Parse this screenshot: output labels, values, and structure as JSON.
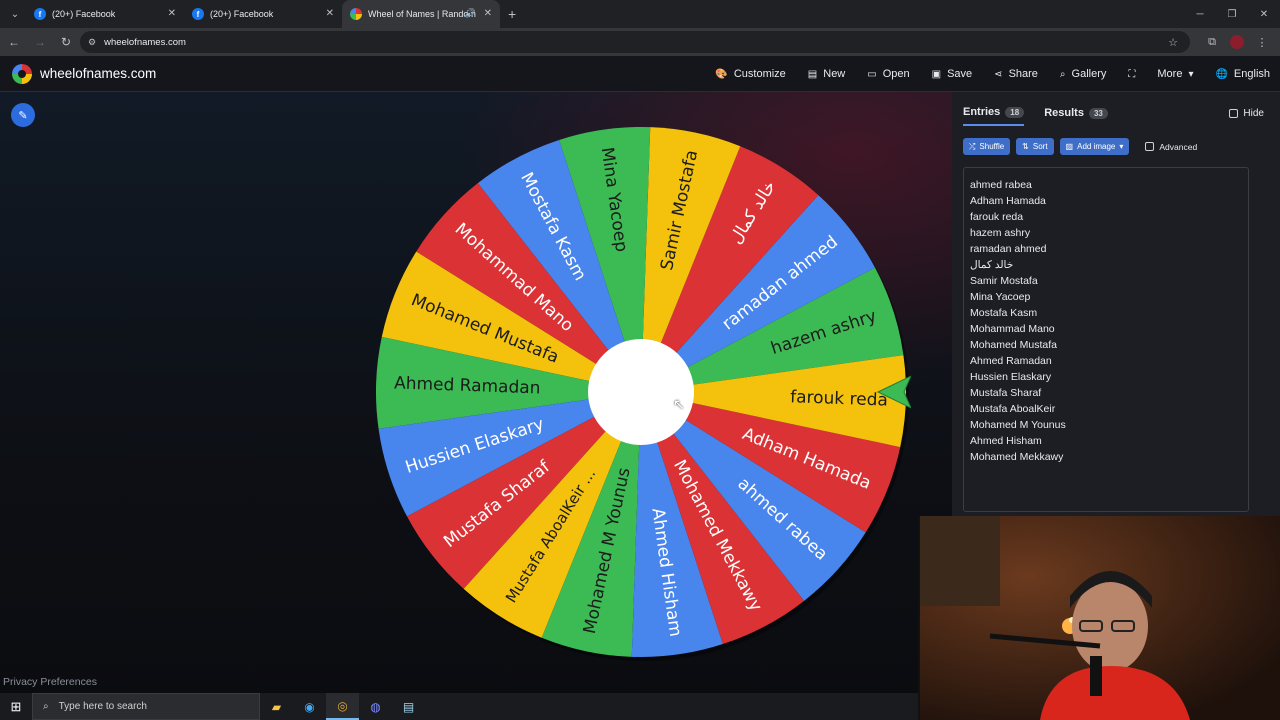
{
  "browser": {
    "tabs": [
      {
        "title": "(20+) Facebook",
        "favicon": "facebook-icon"
      },
      {
        "title": "(20+) Facebook",
        "favicon": "facebook-icon"
      },
      {
        "title": "Wheel of Names | Random",
        "favicon": "wheelofnames-icon",
        "active": true
      }
    ],
    "url": "wheelofnames.com"
  },
  "site": {
    "name": "wheelofnames.com",
    "menu": [
      "Customize",
      "New",
      "Open",
      "Save",
      "Share",
      "Gallery",
      "",
      "More",
      "English"
    ]
  },
  "panel": {
    "tabs": [
      {
        "label": "Entries",
        "count": "18"
      },
      {
        "label": "Results",
        "count": "33"
      }
    ],
    "hide_label": "Hide",
    "buttons": [
      "Shuffle",
      "Sort",
      "Add image"
    ],
    "advanced_label": "Advanced",
    "entries": [
      "ahmed rabea",
      "Adham Hamada",
      "farouk reda",
      "hazem ashry",
      "ramadan ahmed",
      "خالد كمال",
      "Samir Mostafa",
      "Mina Yacoep",
      "Mostafa Kasm",
      "Mohammad Mano",
      "Mohamed Mustafa",
      "Ahmed Ramadan",
      "Hussien Elaskary",
      "Mustafa Sharaf",
      "Mustafa AboalKeir",
      "Mohamed M Younus",
      "Ahmed Hisham",
      "Mohamed Mekkawy"
    ]
  },
  "wheel": {
    "segments": [
      {
        "label": "hazem ashry",
        "color": "#3cba54"
      },
      {
        "label": "ramadan ahmed",
        "color": "#4885ed"
      },
      {
        "label": "خالد كمال",
        "color": "#db3236"
      },
      {
        "label": "Samir Mostafa",
        "color": "#f4c20d"
      },
      {
        "label": "Mina Yacoep",
        "color": "#3cba54"
      },
      {
        "label": "Mostafa Kasm",
        "color": "#4885ed"
      },
      {
        "label": "Mohammad Mano",
        "color": "#db3236"
      },
      {
        "label": "Mohamed Mustafa",
        "color": "#f4c20d"
      },
      {
        "label": "Ahmed Ramadan",
        "color": "#3cba54"
      },
      {
        "label": "Hussien Elaskary",
        "color": "#4885ed"
      },
      {
        "label": "Mustafa Sharaf",
        "color": "#db3236"
      },
      {
        "label": "Mustafa AboalKeir ...",
        "color": "#f4c20d"
      },
      {
        "label": "Mohamed M Younus",
        "color": "#3cba54"
      },
      {
        "label": "Ahmed Hisham",
        "color": "#4885ed"
      },
      {
        "label": "Mohamed Mekkawy",
        "color": "#db3236"
      },
      {
        "label": "ahmed rabea",
        "color": "#4885ed"
      },
      {
        "label": "Adham Hamada",
        "color": "#db3236"
      },
      {
        "label": "farouk reda",
        "color": "#f4c20d"
      }
    ]
  },
  "footer": {
    "privacy": "Privacy Preferences"
  },
  "taskbar": {
    "search_placeholder": "Type here to search"
  }
}
